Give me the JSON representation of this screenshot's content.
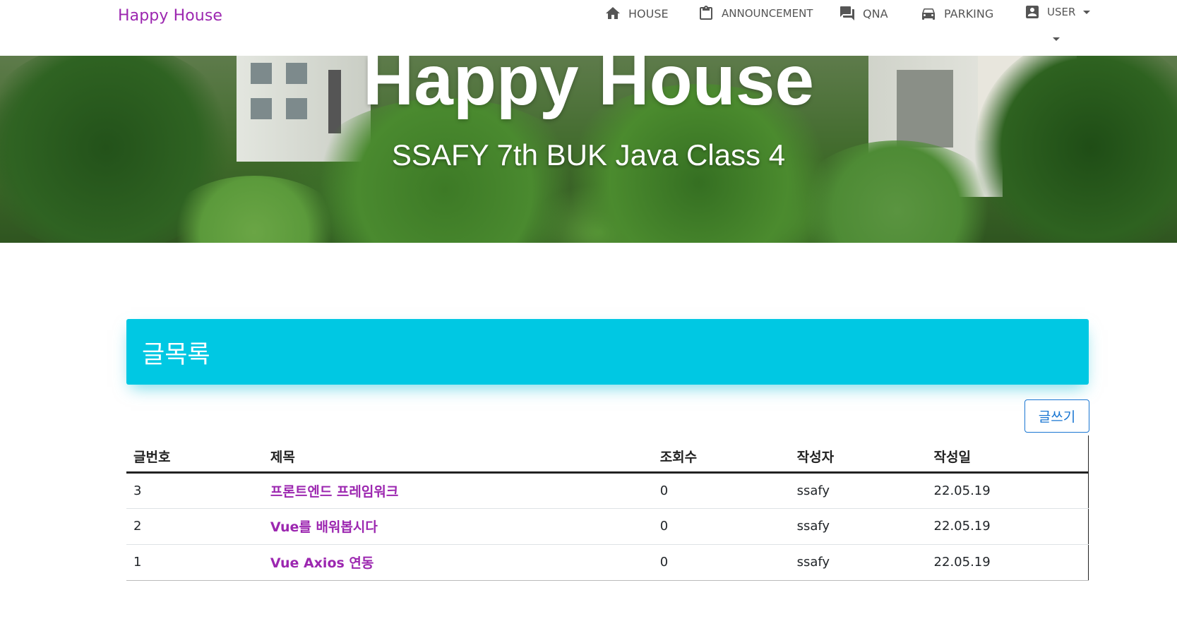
{
  "navbar": {
    "brand": "Happy House",
    "items": [
      {
        "label": "HOUSE",
        "icon": "home-icon"
      },
      {
        "label": "ANNOUNCEMENT",
        "icon": "clipboard-icon"
      },
      {
        "label": "QNA",
        "icon": "forum-icon"
      },
      {
        "label": "PARKING",
        "icon": "car-icon"
      }
    ],
    "user": {
      "label": "USER",
      "icon": "account-box-icon"
    }
  },
  "hero": {
    "title": "Happy House",
    "subtitle": "SSAFY 7th BUK Java Class 4"
  },
  "board": {
    "title": "글목록",
    "write_label": "글쓰기",
    "columns": [
      "글번호",
      "제목",
      "조회수",
      "작성자",
      "작성일"
    ],
    "rows": [
      {
        "no": "3",
        "title": "프론트엔드 프레임워크",
        "views": "0",
        "author": "ssafy",
        "date": "22.05.19"
      },
      {
        "no": "2",
        "title": "Vue를 배워봅시다",
        "views": "0",
        "author": "ssafy",
        "date": "22.05.19"
      },
      {
        "no": "1",
        "title": "Vue Axios 연동",
        "views": "0",
        "author": "ssafy",
        "date": "22.05.19"
      }
    ]
  },
  "colors": {
    "brand": "#9c27b0",
    "header": "#00c8e3",
    "button": "#1976d2"
  }
}
